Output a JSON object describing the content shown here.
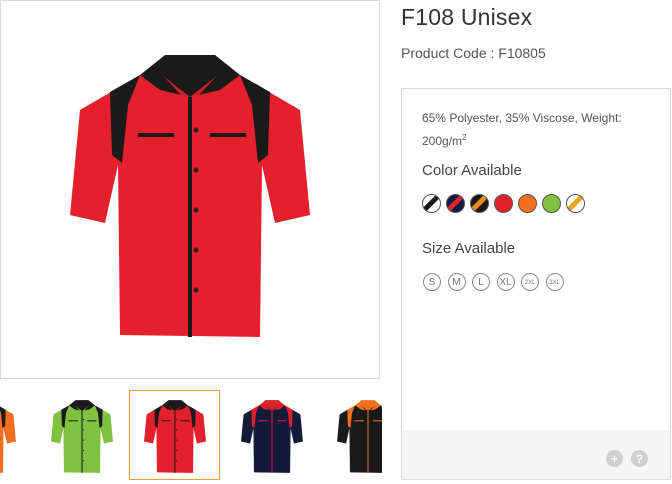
{
  "product": {
    "title": "F108 Unisex",
    "code_label": "Product Code : F10805",
    "description": "65% Polyester, 35% Viscose, Weight: 200g/m",
    "description_sup": "2"
  },
  "colors_section": {
    "title": "Color Available",
    "swatches": [
      {
        "name": "white-black",
        "primary": "#ffffff",
        "accent": "#1a1a1a"
      },
      {
        "name": "navy-red",
        "primary": "#101a45",
        "accent": "#d8232a"
      },
      {
        "name": "black-orange",
        "primary": "#1a1a1a",
        "accent": "#f08a1c"
      },
      {
        "name": "red",
        "primary": "#e3202b",
        "accent": "#e3202b"
      },
      {
        "name": "orange",
        "primary": "#f26f21",
        "accent": "#f26f21"
      },
      {
        "name": "lime-green",
        "primary": "#7fc241",
        "accent": "#7fc241"
      },
      {
        "name": "white-orange",
        "primary": "#ffffff",
        "accent": "#f0a21c"
      }
    ]
  },
  "sizes_section": {
    "title": "Size Available",
    "sizes": [
      "S",
      "M",
      "L",
      "XL",
      "2XL",
      "3XL"
    ]
  },
  "gallery": {
    "main_shirt": {
      "body": "#e3202b",
      "contrast": "#1a1a1a"
    },
    "thumbnails": [
      {
        "name": "orange",
        "body": "#f26f21",
        "contrast": "#1a1a1a"
      },
      {
        "name": "lime-green",
        "body": "#7fc241",
        "contrast": "#1a1a1a"
      },
      {
        "name": "red",
        "body": "#e3202b",
        "contrast": "#1a1a1a",
        "selected": true
      },
      {
        "name": "navy",
        "body": "#131a3a",
        "contrast": "#d8232a"
      },
      {
        "name": "black",
        "body": "#1a1a1a",
        "contrast": "#f26f21"
      }
    ]
  },
  "footer": {
    "plus_label": "+",
    "help_label": "?"
  },
  "accent_colors": {
    "selected_border": "#e0a040",
    "panel_border": "#dcdcdc",
    "footer_bg": "#f5f5f5"
  }
}
